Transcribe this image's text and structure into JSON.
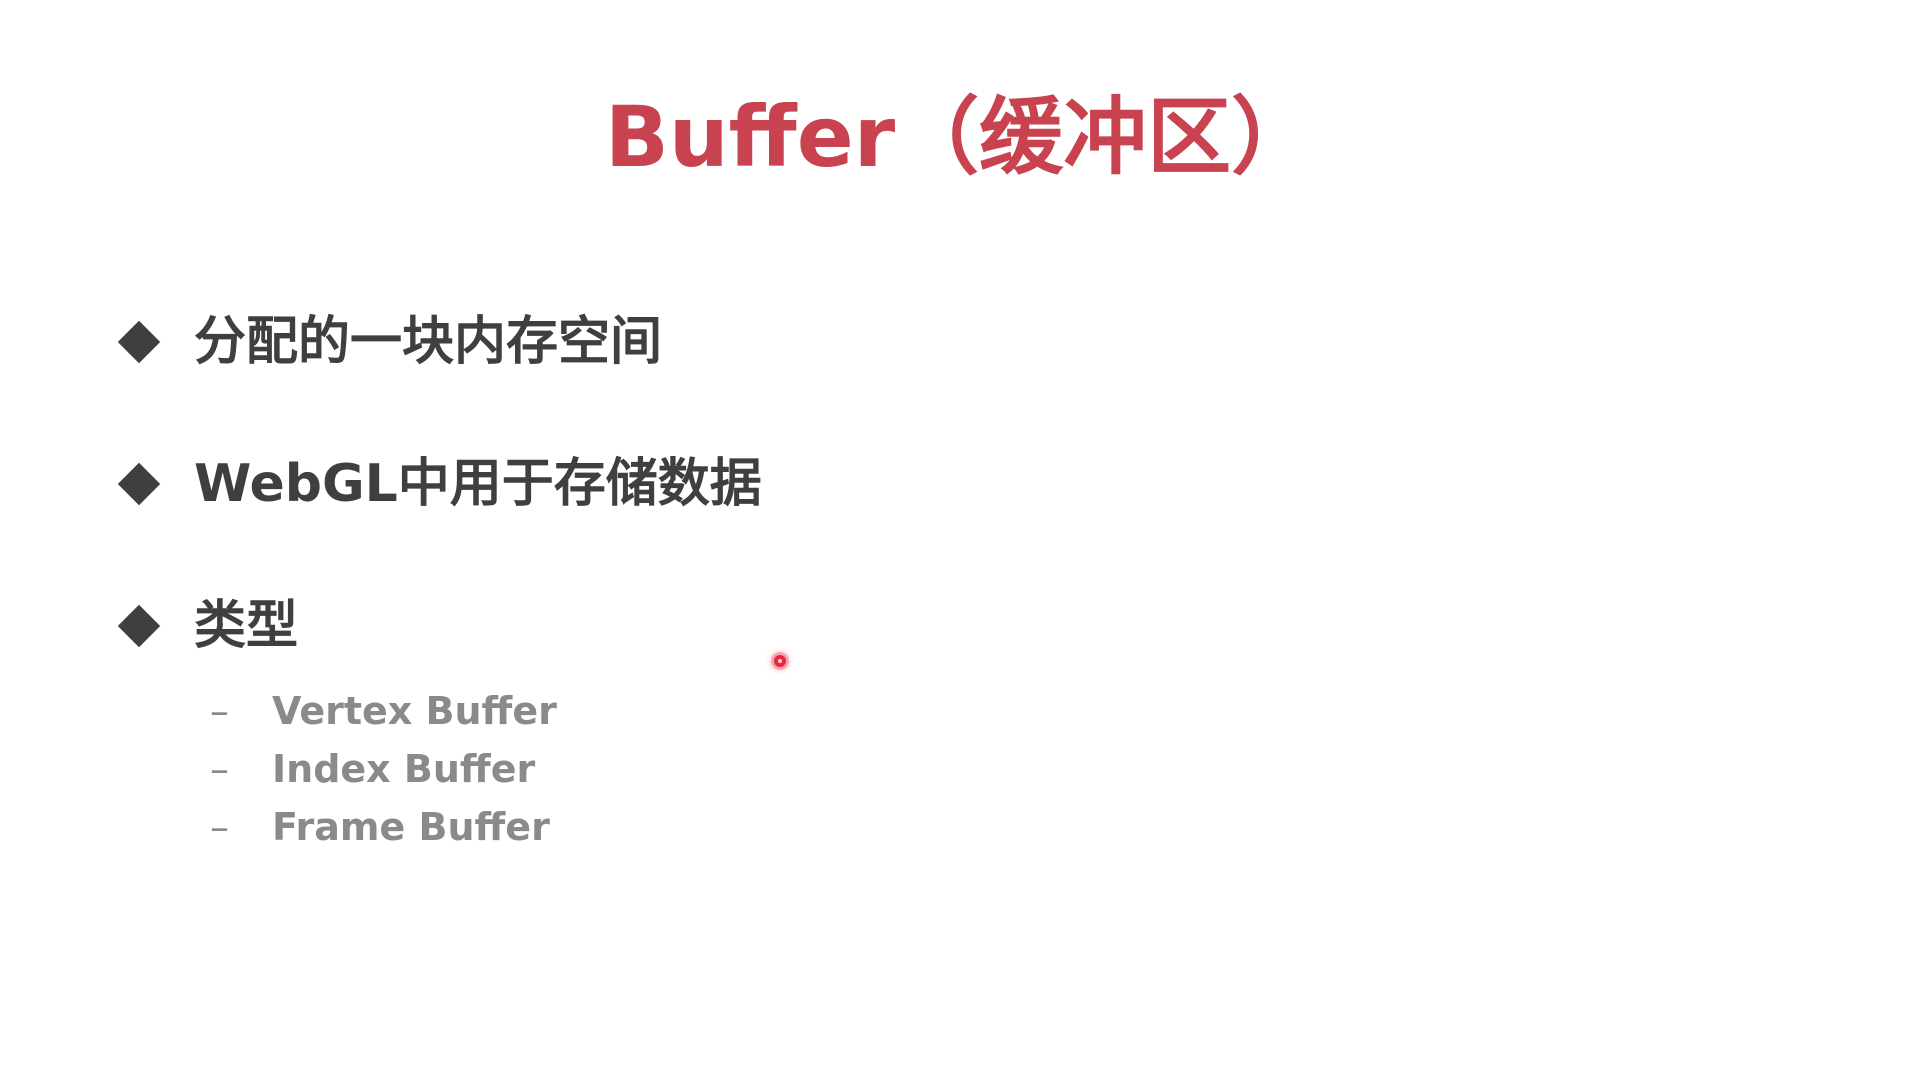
{
  "slide": {
    "title": "Buffer（缓冲区）",
    "bullets": [
      {
        "text": "分配的一块内存空间"
      },
      {
        "text": "WebGL中用于存储数据"
      },
      {
        "text": "类型"
      }
    ],
    "sub_items": [
      {
        "dash": "–",
        "text": "Vertex Buffer"
      },
      {
        "dash": "–",
        "text": "Index Buffer"
      },
      {
        "dash": "–",
        "text": "Frame Buffer"
      }
    ]
  },
  "colors": {
    "title": "#c8424f",
    "bullet_text": "#3f3f3f",
    "bullet_marker": "#3f3f3f",
    "sub_text": "#8a8a8a"
  },
  "icons": {
    "bullet_marker": "diamond-icon",
    "pointer": "laser-pointer-icon"
  }
}
